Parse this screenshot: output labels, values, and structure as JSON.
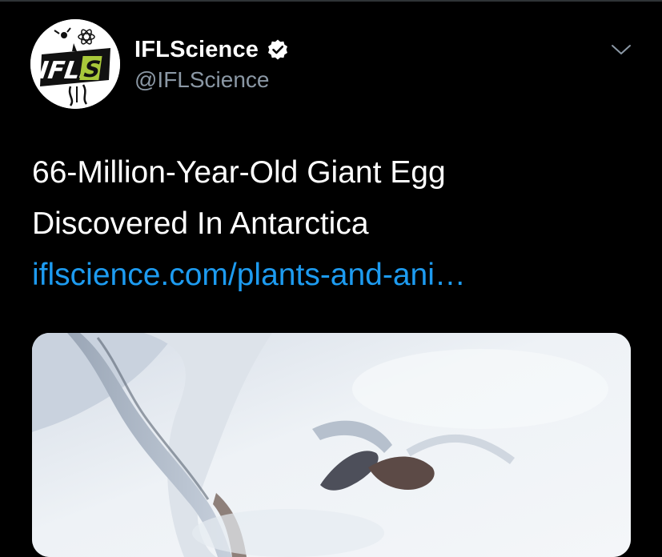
{
  "account": {
    "display_name": "IFLScience",
    "handle": "@IFLScience",
    "verified": true,
    "avatar_icon": "ifls-logo-icon",
    "avatar_text": "IFLS"
  },
  "tweet": {
    "text_lines": [
      "66-Million-Year-Old Giant Egg",
      "Discovered In Antarctica"
    ],
    "link_text": "iflscience.com/plants-and-ani…"
  },
  "media": {
    "image_icon": "antarctica-snow-photo"
  },
  "menu": {
    "icon": "chevron-down-icon"
  },
  "colors": {
    "background": "#000000",
    "text_primary": "#ffffff",
    "text_secondary": "#8b98a5",
    "link": "#1d9bf0",
    "logo_green": "#a8c83a"
  }
}
